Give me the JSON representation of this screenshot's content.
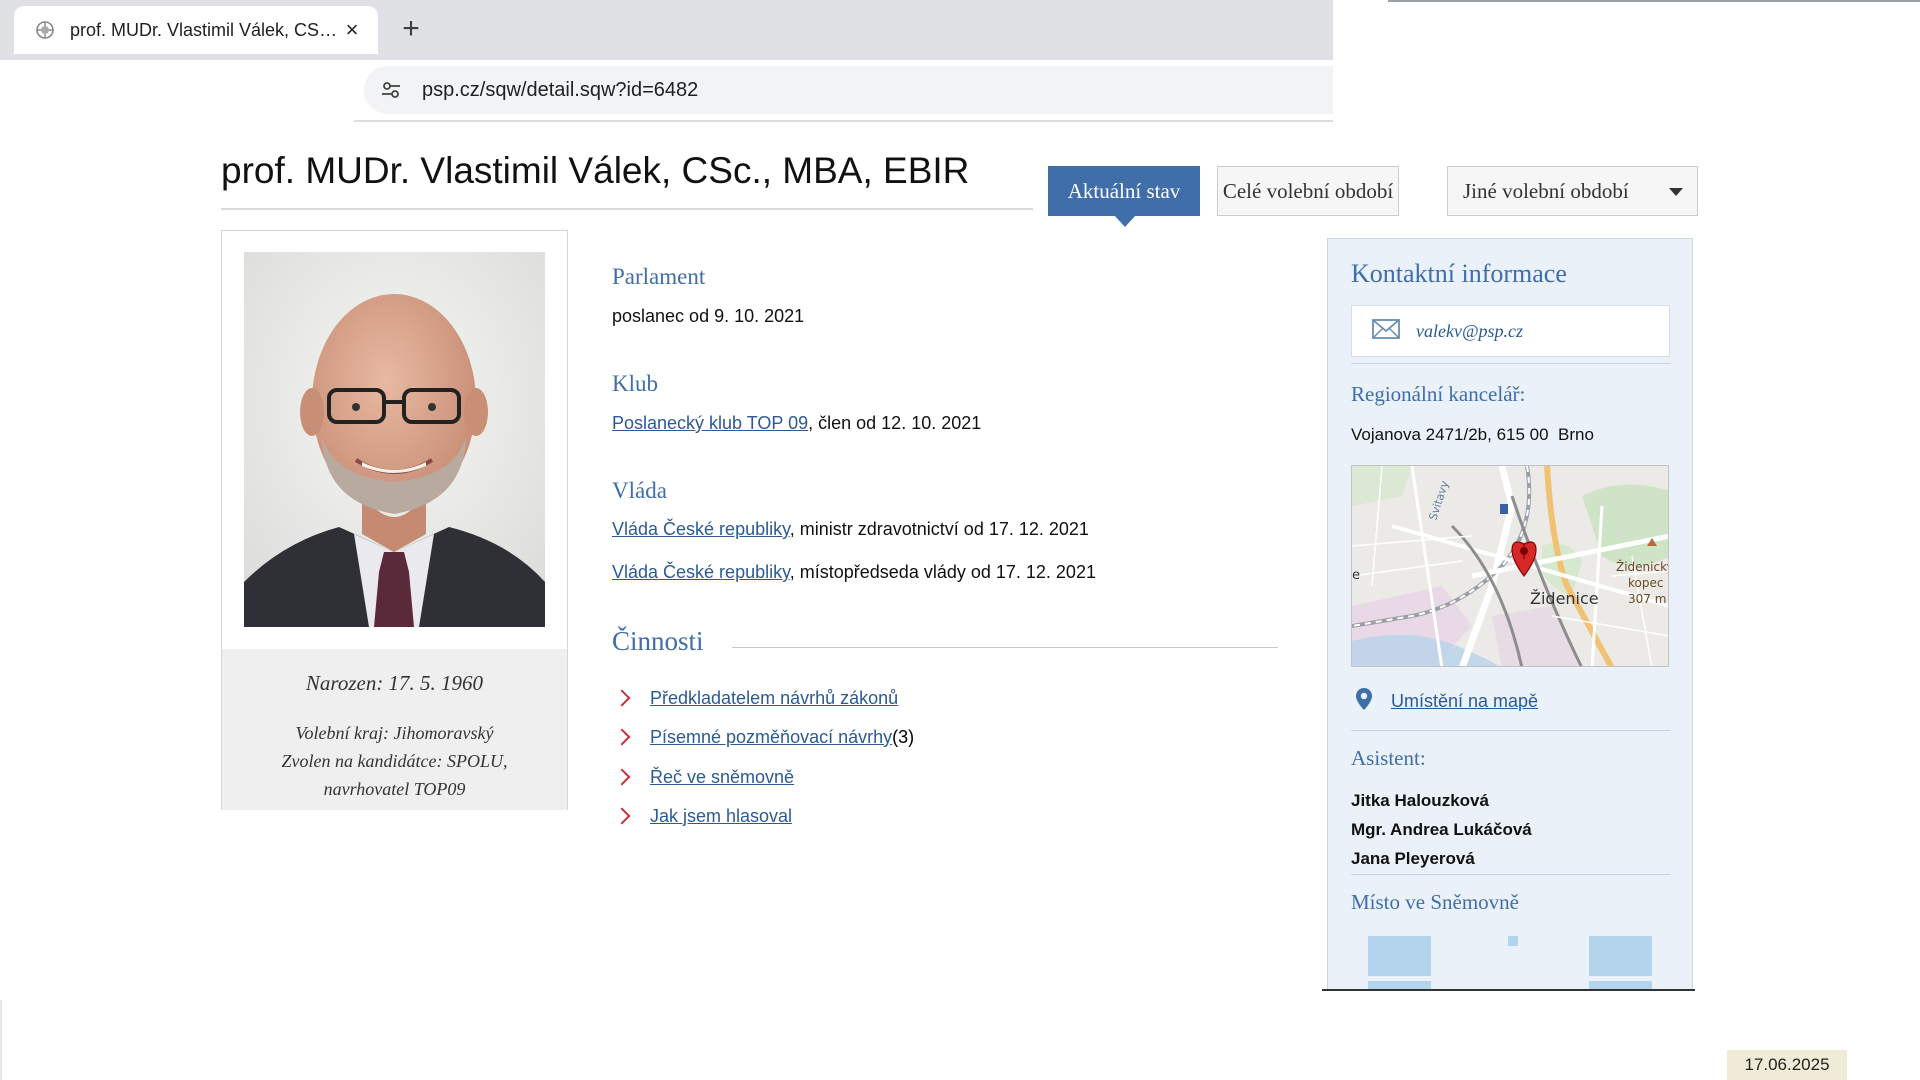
{
  "browser": {
    "tab_title": "prof. MUDr. Vlastimil Válek, CSc., MBA, EBIR",
    "tab_close_label": "×",
    "new_tab_label": "+",
    "url": "psp.cz/sqw/detail.sqw?id=6482"
  },
  "page": {
    "title": "prof. MUDr. Vlastimil Válek, CSc., MBA, EBIR",
    "period_tabs": {
      "current": "Aktuální stav",
      "full": "Celé volební období",
      "other": "Jiné volební období"
    }
  },
  "profile": {
    "born": "Narozen: 17. 5. 1960",
    "region": "Volební kraj: Jihomoravský",
    "candidate_line1": "Zvolen na kandidátce: SPOLU,",
    "candidate_line2": "navrhovatel TOP09"
  },
  "sections": {
    "parliament_head": "Parlament",
    "parliament_text": "poslanec od 9. 10. 2021",
    "club_head": "Klub",
    "club_link": "Poslanecký klub TOP 09",
    "club_rest": ", člen od 12. 10. 2021",
    "gov_head": "Vláda",
    "gov_items": [
      {
        "link": "Vláda České republiky",
        "rest": ", ministr zdravotnictví od 17. 12. 2021"
      },
      {
        "link": "Vláda České republiky",
        "rest": ", místopředseda vlády od 17. 12. 2021"
      }
    ],
    "activities_head": "Činnosti",
    "activities": [
      {
        "label": "Předkladatelem návrhů zákonů",
        "count": ""
      },
      {
        "label": "Písemné pozměňovací návrhy",
        "count": " (3)"
      },
      {
        "label": "Řeč ve sněmovně",
        "count": ""
      },
      {
        "label": "Jak jsem hlasoval",
        "count": ""
      }
    ]
  },
  "contact": {
    "head": "Kontaktní informace",
    "email": "valekv@psp.cz",
    "office_head": "Regionální kancelář:",
    "address": "Vojanova 2471/2b, 615 00  Brno",
    "map_labels": {
      "road": "Svitavy",
      "district": "Židenice",
      "hill1": "Židenický",
      "hill2": "kopec",
      "hill3": "307 m",
      "edge": "e"
    },
    "map_link": "Umístění na mapě",
    "assistant_head": "Asistent:",
    "assistants": [
      "Jitka Halouzková",
      "Mgr. Andrea Lukáčová",
      "Jana Pleyerová"
    ],
    "seat_head": "Místo ve Sněmovně"
  },
  "footer": {
    "date": "17.06.2025"
  },
  "colors": {
    "accent": "#3f6ea8",
    "link": "#2b5a94",
    "chevron": "#c9323a",
    "sidebar_bg": "#eaf1f8"
  }
}
